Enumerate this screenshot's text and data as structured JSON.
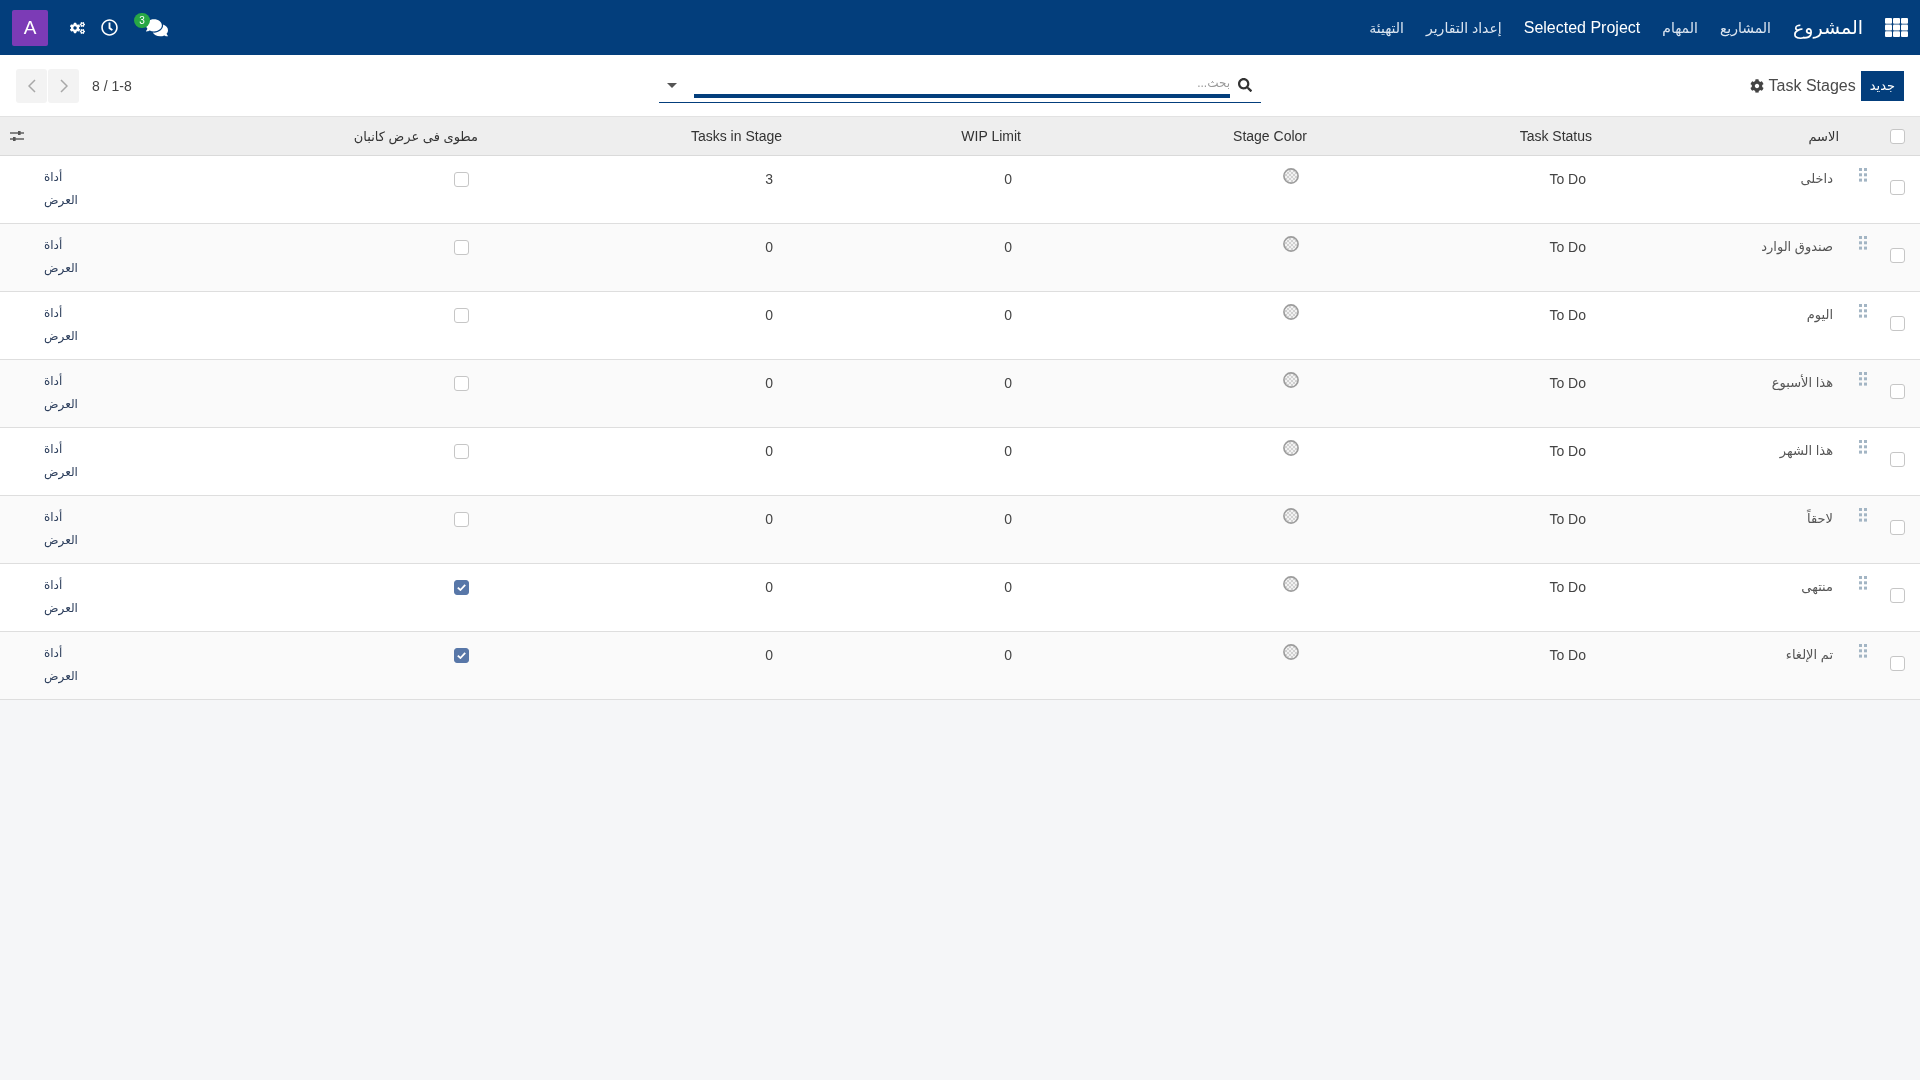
{
  "navbar": {
    "brand": "المشروع",
    "menu": [
      {
        "label": "المشاريع",
        "kind": "menu"
      },
      {
        "label": "المهام",
        "kind": "menu"
      },
      {
        "label": "Selected Project",
        "kind": "project"
      },
      {
        "label": "إعداد التقارير",
        "kind": "menu"
      },
      {
        "label": "التهيئة",
        "kind": "menu"
      }
    ],
    "messages_badge": "3",
    "avatar": "A"
  },
  "control_panel": {
    "new_button": "جديد",
    "title": "Task Stages",
    "search": {
      "placeholder": "بحث..."
    },
    "pager": "8 / 1-8"
  },
  "table": {
    "select_all": {
      "checked": false
    },
    "columns": [
      "الاسم",
      "Task Status",
      "Stage Color",
      "WIP Limit",
      "Tasks in Stage",
      "مطوى فى عرض كانبان"
    ],
    "rows": [
      {
        "name": "داخلى",
        "status": "To Do",
        "wip_limit": "0",
        "tasks_in_stage": "3",
        "folded": false,
        "column_7": "أداة العرض",
        "selected": false
      },
      {
        "name": "صندوق الوارد",
        "status": "To Do",
        "wip_limit": "0",
        "tasks_in_stage": "0",
        "folded": false,
        "column_7": "أداة العرض",
        "selected": false
      },
      {
        "name": "اليوم",
        "status": "To Do",
        "wip_limit": "0",
        "tasks_in_stage": "0",
        "folded": false,
        "column_7": "أداة العرض",
        "selected": false
      },
      {
        "name": "هذا الأسبوع",
        "status": "To Do",
        "wip_limit": "0",
        "tasks_in_stage": "0",
        "folded": false,
        "column_7": "أداة العرض",
        "selected": false
      },
      {
        "name": "هذا الشهر",
        "status": "To Do",
        "wip_limit": "0",
        "tasks_in_stage": "0",
        "folded": false,
        "column_7": "أداة العرض",
        "selected": false
      },
      {
        "name": "لاحقاً",
        "status": "To Do",
        "wip_limit": "0",
        "tasks_in_stage": "0",
        "folded": false,
        "column_7": "أداة العرض",
        "selected": false
      },
      {
        "name": "منتهى",
        "status": "To Do",
        "wip_limit": "0",
        "tasks_in_stage": "0",
        "folded": true,
        "column_7": "أداة العرض",
        "selected": false
      },
      {
        "name": "تم الإلغاء",
        "status": "To Do",
        "wip_limit": "0",
        "tasks_in_stage": "0",
        "folded": true,
        "column_7": "أداة العرض",
        "selected": false
      }
    ]
  }
}
